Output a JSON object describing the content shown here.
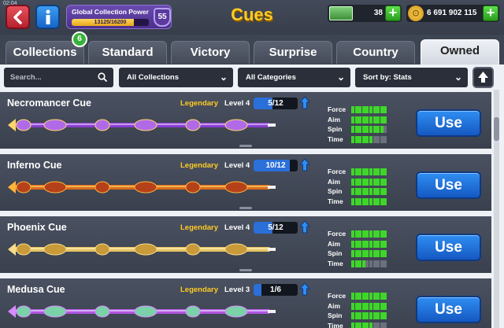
{
  "status_bar": {
    "time": "02:04"
  },
  "header": {
    "title": "Cues",
    "collection_power": {
      "label": "Global Collection Power",
      "progress_text": "13125/16200",
      "progress": 0.81,
      "level": "55"
    },
    "cash": "38",
    "coins": "6 691 902 115",
    "back_icon": "back-arrow-icon",
    "info_icon": "info-icon"
  },
  "tabs": [
    {
      "label": "Collections"
    },
    {
      "label": "Standard"
    },
    {
      "label": "Victory"
    },
    {
      "label": "Surprise"
    },
    {
      "label": "Country"
    },
    {
      "label": "Owned",
      "active": true
    }
  ],
  "collections_badge": "6",
  "filters": {
    "search_placeholder": "Search...",
    "collection": "All Collections",
    "category": "All Categories",
    "sort": "Sort by: Stats"
  },
  "stat_labels": {
    "force": "Force",
    "aim": "Aim",
    "spin": "Spin",
    "time": "Time"
  },
  "cues": [
    {
      "name": "Necromancer Cue",
      "rarity": "Legendary",
      "level": "Level 4",
      "progress": "5/12",
      "progress_value": 0.42,
      "use_label": "Use",
      "stats": {
        "force": 10,
        "aim": 10,
        "spin": 9,
        "time": 6
      },
      "colors": [
        "#8a3fd1",
        "#e0c3ff",
        "#b06ae8",
        "#ffd46b"
      ]
    },
    {
      "name": "Inferno Cue",
      "rarity": "Legendary",
      "level": "Level 4",
      "progress": "10/12",
      "progress_value": 0.83,
      "use_label": "Use",
      "stats": {
        "force": 10,
        "aim": 10,
        "spin": 10,
        "time": 10
      },
      "colors": [
        "#d96b1c",
        "#ffd36a",
        "#b5411a",
        "#ffb43a"
      ]
    },
    {
      "name": "Phoenix Cue",
      "rarity": "Legendary",
      "level": "Level 4",
      "progress": "5/12",
      "progress_value": 0.42,
      "use_label": "Use",
      "stats": {
        "force": 10,
        "aim": 10,
        "spin": 10,
        "time": 4
      },
      "colors": [
        "#e6c464",
        "#fff1b8",
        "#c99a3a",
        "#f7dc8a"
      ]
    },
    {
      "name": "Medusa Cue",
      "rarity": "Legendary",
      "level": "Level 3",
      "progress": "1/6",
      "progress_value": 0.17,
      "use_label": "Use",
      "stats": {
        "force": 10,
        "aim": 10,
        "spin": 10,
        "time": 6
      },
      "colors": [
        "#b056e0",
        "#e8d6ff",
        "#7bd1a8",
        "#d88cff"
      ]
    }
  ]
}
